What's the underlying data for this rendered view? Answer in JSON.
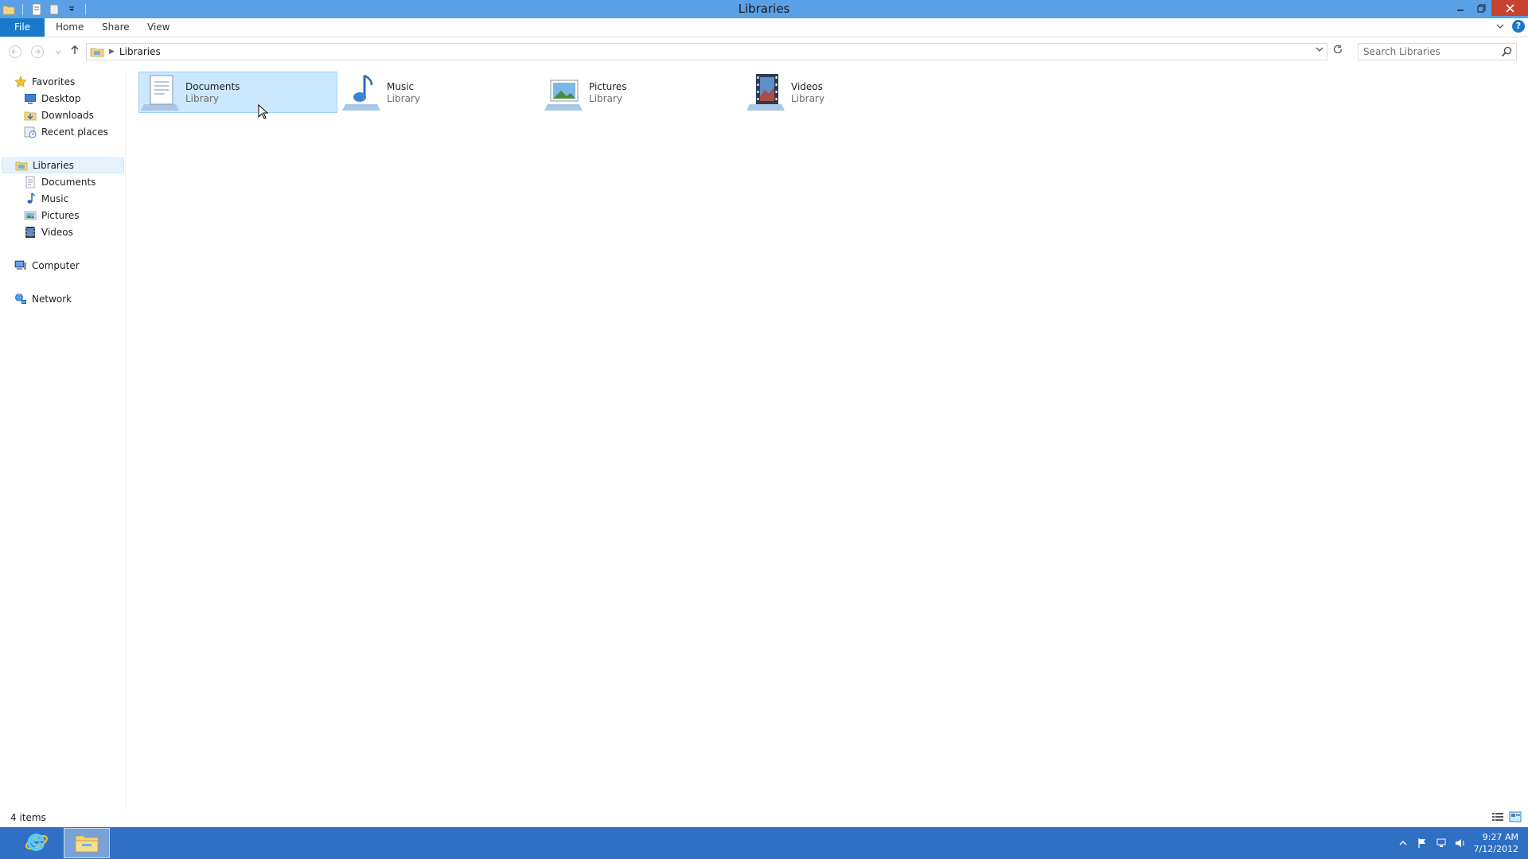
{
  "window": {
    "title": "Libraries"
  },
  "ribbon": {
    "tabs": [
      "File",
      "Home",
      "Share",
      "View"
    ]
  },
  "address": {
    "crumbs": [
      "Libraries"
    ]
  },
  "search": {
    "placeholder": "Search Libraries"
  },
  "nav": {
    "favorites": {
      "label": "Favorites",
      "items": [
        "Desktop",
        "Downloads",
        "Recent places"
      ]
    },
    "libraries": {
      "label": "Libraries",
      "items": [
        "Documents",
        "Music",
        "Pictures",
        "Videos"
      ]
    },
    "computer": {
      "label": "Computer"
    },
    "network": {
      "label": "Network"
    }
  },
  "content": {
    "items": [
      {
        "name": "Documents",
        "type": "Library",
        "icon": "documents-library-icon",
        "selected": true
      },
      {
        "name": "Music",
        "type": "Library",
        "icon": "music-library-icon",
        "selected": false
      },
      {
        "name": "Pictures",
        "type": "Library",
        "icon": "pictures-library-icon",
        "selected": false
      },
      {
        "name": "Videos",
        "type": "Library",
        "icon": "videos-library-icon",
        "selected": false
      }
    ]
  },
  "status": {
    "item_count": "4 items"
  },
  "taskbar": {
    "time": "9:27 AM",
    "date": "7/12/2012",
    "apps": [
      "internet-explorer-icon",
      "file-explorer-icon"
    ]
  },
  "colors": {
    "titlebar": "#5aa0e6",
    "file_tab": "#1979ca",
    "close_button": "#c7432f",
    "selection": "#cce8ff",
    "taskbar": "#2f6fc4"
  }
}
